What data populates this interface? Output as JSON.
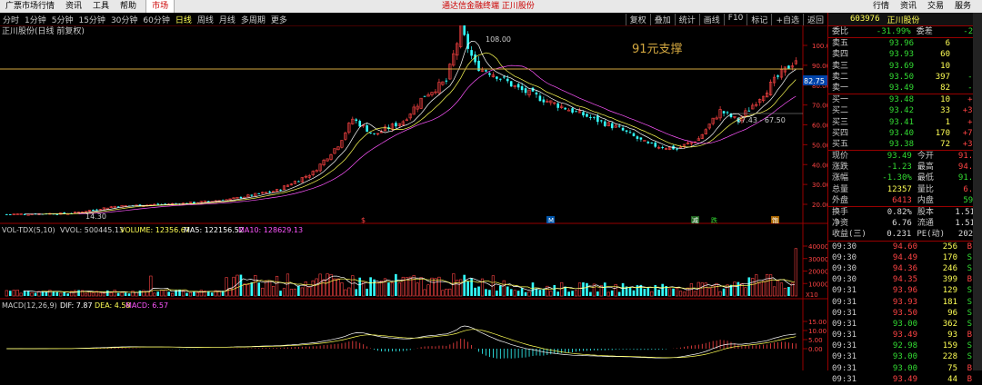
{
  "menubar": {
    "items": [
      "广票市场行情",
      "资讯",
      "工具",
      "帮助"
    ],
    "market_tab": "市场",
    "center_text": "通达信金融终端 正川股份",
    "right_items": [
      "行情",
      "资讯",
      "交易",
      "服务"
    ]
  },
  "toolbar": {
    "periods": [
      "分时",
      "1分钟",
      "5分钟",
      "15分钟",
      "30分钟",
      "60分钟",
      "日线",
      "周线",
      "月线",
      "多周期",
      "更多"
    ],
    "active": "日线",
    "right_buttons": [
      "复权",
      "叠加",
      "统计",
      "画线",
      "F10",
      "标记",
      "+自选",
      "返回"
    ]
  },
  "main": {
    "title": "正川股份(日线 前复权)",
    "annotation": "91元支撑",
    "high_label": "108.00",
    "low_label": "14.30",
    "range_label": "67.43 - 67.50",
    "current_price_tag": "82.75",
    "event_markers": [
      "$",
      "M",
      "减",
      "跌",
      "饱"
    ],
    "y_ticks": [
      "100.00",
      "90.00",
      "80.00",
      "70.00",
      "60.00",
      "50.00",
      "40.00",
      "30.00",
      "20.00"
    ]
  },
  "vol": {
    "header_name": "VOL-TDX(5,10)",
    "vvol": "VVOL: 500445.13",
    "volume": "VOLUME: 12356.67",
    "ma5": "MA5: 122156.52",
    "ma10": "MA10: 128629.13",
    "y_ticks": [
      "40000",
      "30000",
      "20000",
      "10000"
    ],
    "unit": "X10"
  },
  "macd": {
    "header_name": "MACD(12,26,9)",
    "dif": "DIF: 7.87",
    "dea": "DEA: 4.58",
    "macd": "MACD: 6.57",
    "y_ticks": [
      "15.00",
      "10.00",
      "5.00",
      "0.00"
    ]
  },
  "quote": {
    "code": "603976",
    "name": "正川股份",
    "weibi_label": "委比",
    "weibi": "-31.99%",
    "weicha_label": "委差",
    "weicha": "-269",
    "asks": [
      {
        "label": "卖五",
        "price": "93.96",
        "vol": "6",
        "d": ""
      },
      {
        "label": "卖四",
        "price": "93.93",
        "vol": "60",
        "d": ""
      },
      {
        "label": "卖三",
        "price": "93.69",
        "vol": "10",
        "d": ""
      },
      {
        "label": "卖二",
        "price": "93.50",
        "vol": "397",
        "d": "-7"
      },
      {
        "label": "卖一",
        "price": "93.49",
        "vol": "82",
        "d": "-7"
      }
    ],
    "bids": [
      {
        "label": "买一",
        "price": "93.48",
        "vol": "10",
        "d": "+9"
      },
      {
        "label": "买二",
        "price": "93.42",
        "vol": "33",
        "d": "+33"
      },
      {
        "label": "买三",
        "price": "93.41",
        "vol": "1",
        "d": "+1"
      },
      {
        "label": "买四",
        "price": "93.40",
        "vol": "170",
        "d": "+70"
      },
      {
        "label": "买五",
        "price": "93.38",
        "vol": "72",
        "d": "+37"
      }
    ],
    "stats": [
      {
        "l1": "现价",
        "v1": "93.49",
        "c1": "grn",
        "l2": "今开",
        "v2": "91.69",
        "c2": "red"
      },
      {
        "l1": "涨跌",
        "v1": "-1.23",
        "c1": "grn",
        "l2": "最高",
        "v2": "94.60",
        "c2": "red"
      },
      {
        "l1": "涨幅",
        "v1": "-1.30%",
        "c1": "grn",
        "l2": "最低",
        "v2": "91.45",
        "c2": "grn"
      },
      {
        "l1": "总量",
        "v1": "12357",
        "c1": "yel",
        "l2": "量比",
        "v2": "6.33",
        "c2": "red"
      },
      {
        "l1": "外盘",
        "v1": "6413",
        "c1": "red",
        "l2": "内盘",
        "v2": "5944",
        "c2": "grn"
      }
    ],
    "stats2": [
      {
        "l1": "换手",
        "v1": "0.82%",
        "c1": "wht",
        "l2": "股本",
        "v2": "1.51亿",
        "c2": "wht"
      },
      {
        "l1": "净资",
        "v1": "6.76",
        "c1": "wht",
        "l2": "流通",
        "v2": "1.51亿",
        "c2": "wht"
      },
      {
        "l1": "收益(三)",
        "v1": "0.231",
        "c1": "wht",
        "l2": "PE(动)",
        "v2": "202.4",
        "c2": "wht"
      }
    ],
    "ticks": [
      {
        "t": "09:30",
        "p": "94.60",
        "v": "256",
        "f": "B"
      },
      {
        "t": "09:30",
        "p": "94.49",
        "v": "170",
        "f": "S"
      },
      {
        "t": "09:30",
        "p": "94.36",
        "v": "246",
        "f": "S"
      },
      {
        "t": "09:30",
        "p": "94.35",
        "v": "399",
        "f": "B"
      },
      {
        "t": "09:31",
        "p": "93.96",
        "v": "129",
        "f": "S"
      },
      {
        "t": "09:31",
        "p": "93.93",
        "v": "181",
        "f": "S"
      },
      {
        "t": "09:31",
        "p": "93.50",
        "v": "96",
        "f": "S"
      },
      {
        "t": "09:31",
        "p": "93.00",
        "v": "362",
        "f": "S"
      },
      {
        "t": "09:31",
        "p": "93.49",
        "v": "93",
        "f": "B"
      },
      {
        "t": "09:31",
        "p": "92.98",
        "v": "159",
        "f": "S"
      },
      {
        "t": "09:31",
        "p": "93.00",
        "v": "228",
        "f": "S"
      },
      {
        "t": "09:31",
        "p": "93.00",
        "v": "75",
        "f": "B"
      },
      {
        "t": "09:31",
        "p": "93.49",
        "v": "44",
        "f": "B"
      }
    ]
  },
  "colors": {
    "up": "#ff4444",
    "down": "#33ffff",
    "ma5": "#ffffff",
    "ma10": "#ffff55",
    "ma20": "#ff55ff",
    "support": "#d4a840"
  }
}
